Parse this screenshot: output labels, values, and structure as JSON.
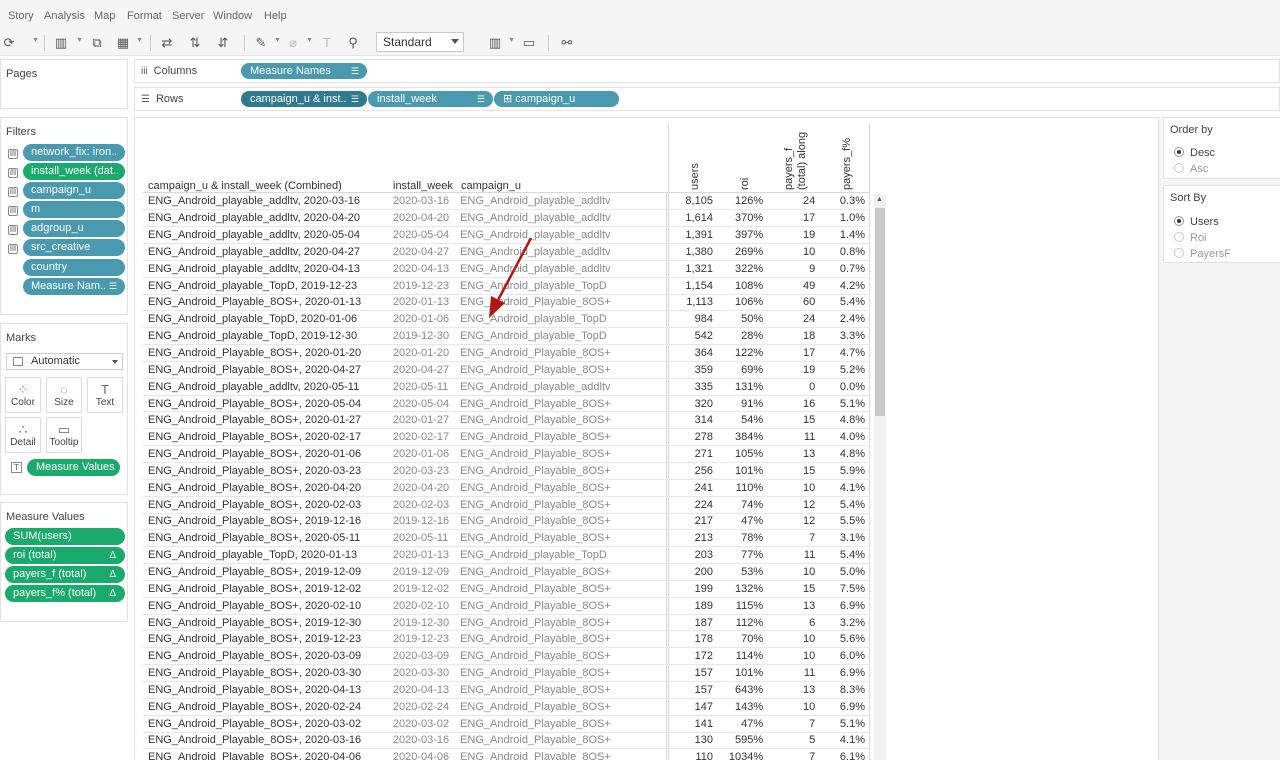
{
  "menu": [
    "Story",
    "Analysis",
    "Map",
    "Format",
    "Server",
    "Window",
    "Help"
  ],
  "toolbar": {
    "fit_mode": "Standard"
  },
  "pages": {
    "title": "Pages"
  },
  "columns_shelf": {
    "label": "Columns",
    "pills": [
      "Measure Names"
    ]
  },
  "rows_shelf": {
    "label": "Rows",
    "pills": [
      "campaign_u & inst..",
      "install_week",
      "campaign_u"
    ]
  },
  "filters": {
    "title": "Filters",
    "items": [
      "network_fix: iron..",
      "install_week (dat..",
      "campaign_u",
      "m",
      "adgroup_u",
      "src_creative",
      "country",
      "Measure Nam.."
    ]
  },
  "marks": {
    "title": "Marks",
    "type": "Automatic",
    "buttons": [
      "Color",
      "Size",
      "Text",
      "Detail",
      "Tooltip"
    ],
    "text_pill": "Measure Values"
  },
  "measure_values": {
    "title": "Measure Values",
    "items": [
      "SUM(users)",
      "roi (total)",
      "payers_f (total)",
      "payers_f% (total)"
    ]
  },
  "table": {
    "headers": {
      "combined": "campaign_u & install_week (Combined)",
      "install_week": "install_week",
      "campaign": "campaign_u",
      "users": "users",
      "roi": "roi",
      "payers_line1": "payers_f",
      "payers_line2": "(total) along",
      "payers_pct": "payers_f%"
    },
    "rows": [
      [
        "ENG_Android_playable_addltv, 2020-03-16",
        "2020-03-16",
        "ENG_Android_playable_addltv",
        "8,105",
        "126%",
        "24",
        "0.3%"
      ],
      [
        "ENG_Android_playable_addltv, 2020-04-20",
        "2020-04-20",
        "ENG_Android_playable_addltv",
        "1,614",
        "370%",
        "17",
        "1.0%"
      ],
      [
        "ENG_Android_playable_addltv, 2020-05-04",
        "2020-05-04",
        "ENG_Android_playable_addltv",
        "1,391",
        "397%",
        "19",
        "1.4%"
      ],
      [
        "ENG_Android_playable_addltv, 2020-04-27",
        "2020-04-27",
        "ENG_Android_playable_addltv",
        "1,380",
        "269%",
        "10",
        "0.8%"
      ],
      [
        "ENG_Android_playable_addltv, 2020-04-13",
        "2020-04-13",
        "ENG_Android_playable_addltv",
        "1,321",
        "322%",
        "9",
        "0.7%"
      ],
      [
        "ENG_Android_playable_TopD, 2019-12-23",
        "2019-12-23",
        "ENG_Android_playable_TopD",
        "1,154",
        "108%",
        "49",
        "4.2%"
      ],
      [
        "ENG_Android_Playable_8OS+, 2020-01-13",
        "2020-01-13",
        "ENG_Android_Playable_8OS+",
        "1,113",
        "106%",
        "60",
        "5.4%"
      ],
      [
        "ENG_Android_playable_TopD, 2020-01-06",
        "2020-01-06",
        "ENG_Android_playable_TopD",
        "984",
        "50%",
        "24",
        "2.4%"
      ],
      [
        "ENG_Android_playable_TopD, 2019-12-30",
        "2019-12-30",
        "ENG_Android_playable_TopD",
        "542",
        "28%",
        "18",
        "3.3%"
      ],
      [
        "ENG_Android_Playable_8OS+, 2020-01-20",
        "2020-01-20",
        "ENG_Android_Playable_8OS+",
        "364",
        "122%",
        "17",
        "4.7%"
      ],
      [
        "ENG_Android_Playable_8OS+, 2020-04-27",
        "2020-04-27",
        "ENG_Android_Playable_8OS+",
        "359",
        "69%",
        "19",
        "5.2%"
      ],
      [
        "ENG_Android_playable_addltv, 2020-05-11",
        "2020-05-11",
        "ENG_Android_playable_addltv",
        "335",
        "131%",
        "0",
        "0.0%"
      ],
      [
        "ENG_Android_Playable_8OS+, 2020-05-04",
        "2020-05-04",
        "ENG_Android_Playable_8OS+",
        "320",
        "91%",
        "16",
        "5.1%"
      ],
      [
        "ENG_Android_Playable_8OS+, 2020-01-27",
        "2020-01-27",
        "ENG_Android_Playable_8OS+",
        "314",
        "54%",
        "15",
        "4.8%"
      ],
      [
        "ENG_Android_Playable_8OS+, 2020-02-17",
        "2020-02-17",
        "ENG_Android_Playable_8OS+",
        "278",
        "384%",
        "11",
        "4.0%"
      ],
      [
        "ENG_Android_Playable_8OS+, 2020-01-06",
        "2020-01-06",
        "ENG_Android_Playable_8OS+",
        "271",
        "105%",
        "13",
        "4.8%"
      ],
      [
        "ENG_Android_Playable_8OS+, 2020-03-23",
        "2020-03-23",
        "ENG_Android_Playable_8OS+",
        "256",
        "101%",
        "15",
        "5.9%"
      ],
      [
        "ENG_Android_Playable_8OS+, 2020-04-20",
        "2020-04-20",
        "ENG_Android_Playable_8OS+",
        "241",
        "110%",
        "10",
        "4.1%"
      ],
      [
        "ENG_Android_Playable_8OS+, 2020-02-03",
        "2020-02-03",
        "ENG_Android_Playable_8OS+",
        "224",
        "74%",
        "12",
        "5.4%"
      ],
      [
        "ENG_Android_Playable_8OS+, 2019-12-16",
        "2019-12-16",
        "ENG_Android_Playable_8OS+",
        "217",
        "47%",
        "12",
        "5.5%"
      ],
      [
        "ENG_Android_Playable_8OS+, 2020-05-11",
        "2020-05-11",
        "ENG_Android_Playable_8OS+",
        "213",
        "78%",
        "7",
        "3.1%"
      ],
      [
        "ENG_Android_playable_TopD, 2020-01-13",
        "2020-01-13",
        "ENG_Android_playable_TopD",
        "203",
        "77%",
        "11",
        "5.4%"
      ],
      [
        "ENG_Android_Playable_8OS+, 2019-12-09",
        "2019-12-09",
        "ENG_Android_Playable_8OS+",
        "200",
        "53%",
        "10",
        "5.0%"
      ],
      [
        "ENG_Android_Playable_8OS+, 2019-12-02",
        "2019-12-02",
        "ENG_Android_Playable_8OS+",
        "199",
        "132%",
        "15",
        "7.5%"
      ],
      [
        "ENG_Android_Playable_8OS+, 2020-02-10",
        "2020-02-10",
        "ENG_Android_Playable_8OS+",
        "189",
        "115%",
        "13",
        "6.9%"
      ],
      [
        "ENG_Android_Playable_8OS+, 2019-12-30",
        "2019-12-30",
        "ENG_Android_Playable_8OS+",
        "187",
        "112%",
        "6",
        "3.2%"
      ],
      [
        "ENG_Android_Playable_8OS+, 2019-12-23",
        "2019-12-23",
        "ENG_Android_Playable_8OS+",
        "178",
        "70%",
        "10",
        "5.6%"
      ],
      [
        "ENG_Android_Playable_8OS+, 2020-03-09",
        "2020-03-09",
        "ENG_Android_Playable_8OS+",
        "172",
        "114%",
        "10",
        "6.0%"
      ],
      [
        "ENG_Android_Playable_8OS+, 2020-03-30",
        "2020-03-30",
        "ENG_Android_Playable_8OS+",
        "157",
        "101%",
        "11",
        "6.9%"
      ],
      [
        "ENG_Android_Playable_8OS+, 2020-04-13",
        "2020-04-13",
        "ENG_Android_Playable_8OS+",
        "157",
        "643%",
        "13",
        "8.3%"
      ],
      [
        "ENG_Android_Playable_8OS+, 2020-02-24",
        "2020-02-24",
        "ENG_Android_Playable_8OS+",
        "147",
        "143%",
        "10",
        "6.9%"
      ],
      [
        "ENG_Android_Playable_8OS+, 2020-03-02",
        "2020-03-02",
        "ENG_Android_Playable_8OS+",
        "141",
        "47%",
        "7",
        "5.1%"
      ],
      [
        "ENG_Android_Playable_8OS+, 2020-03-16",
        "2020-03-16",
        "ENG_Android_Playable_8OS+",
        "130",
        "595%",
        "5",
        "4.1%"
      ],
      [
        "ENG_Android_Playable_8OS+, 2020-04-06",
        "2020-04-06",
        "ENG_Android_Playable_8OS+",
        "110",
        "1034%",
        "7",
        "6.1%"
      ]
    ]
  },
  "order_by": {
    "title": "Order by",
    "options": [
      "Desc",
      "Asc"
    ],
    "selected": "Desc"
  },
  "sort_by": {
    "title": "Sort By",
    "options": [
      "Users",
      "Roi",
      "PayersF"
    ],
    "selected": "Users"
  },
  "colors": {
    "blue_pill": "#4a9aaf",
    "green_pill": "#1aaa6c",
    "annotation_arrow": "#b01818"
  }
}
